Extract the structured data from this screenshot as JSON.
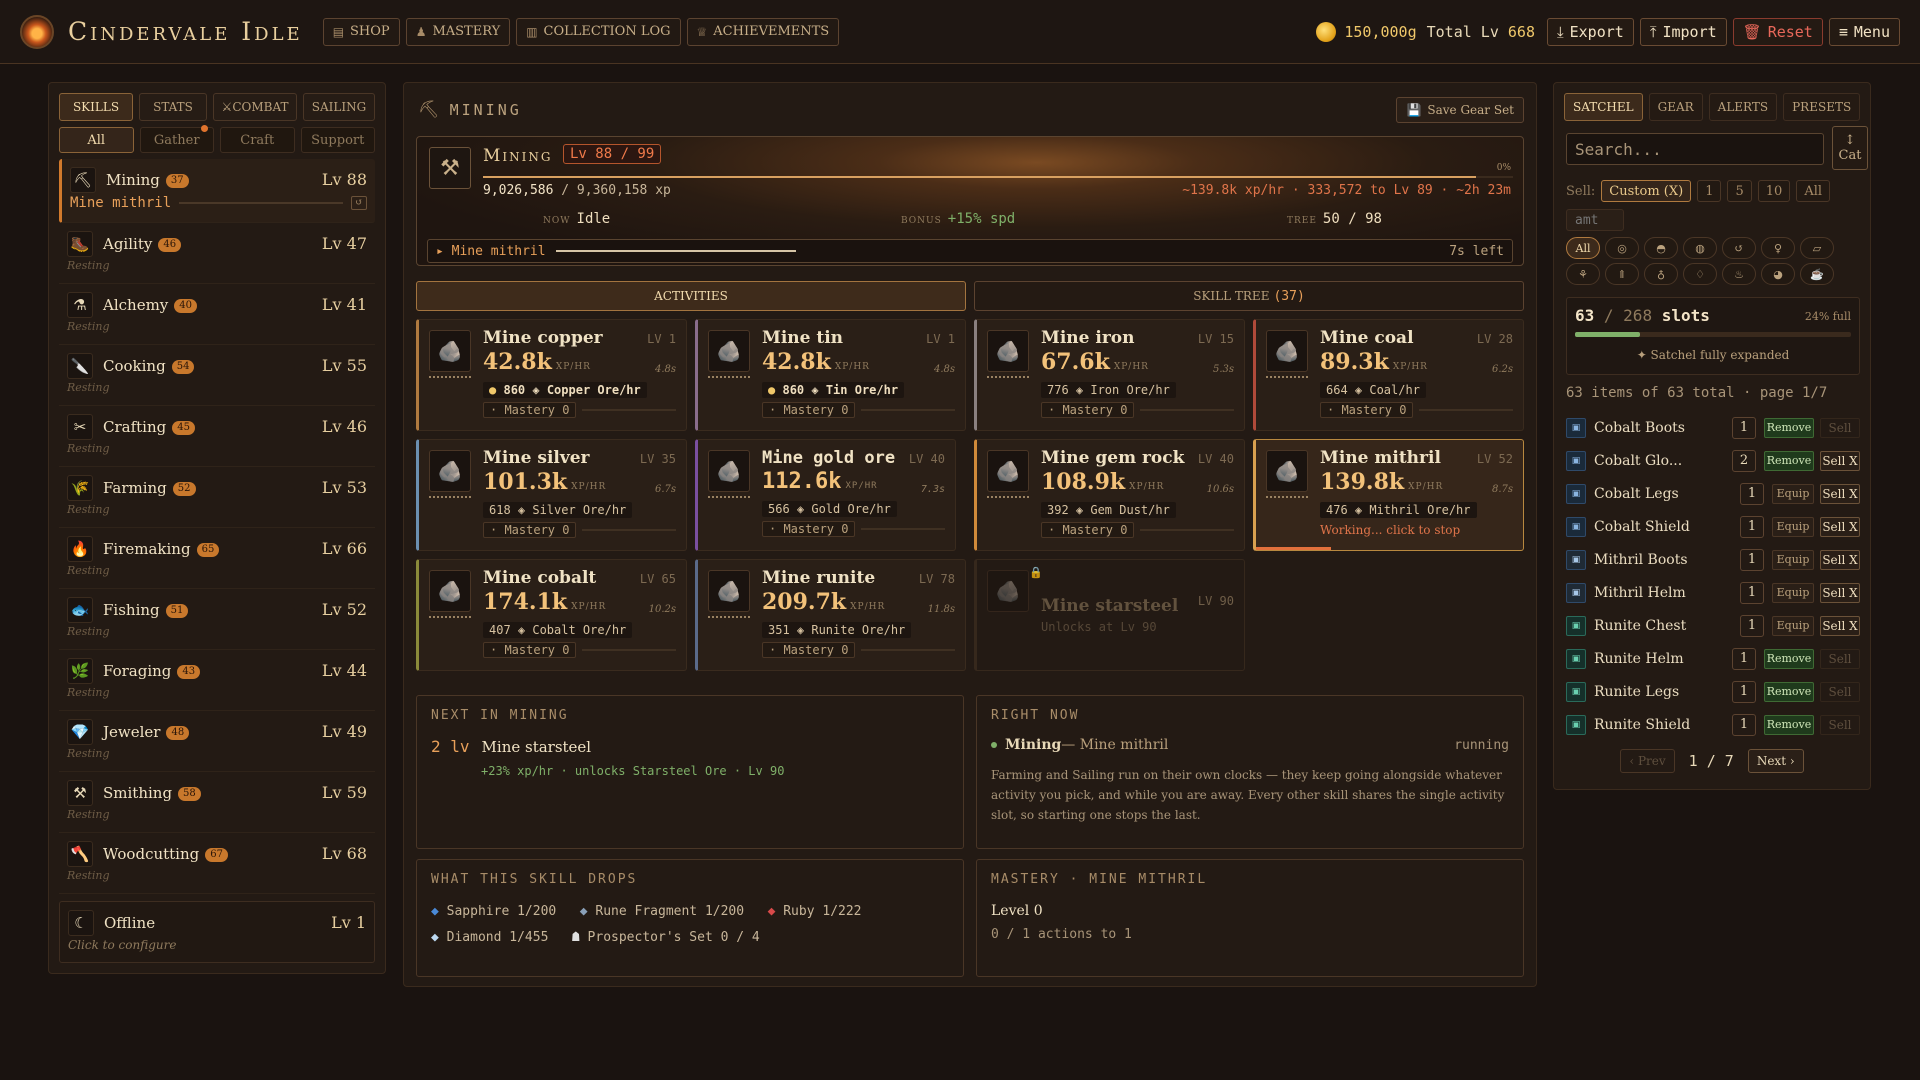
{
  "app": {
    "title": "Cindervale Idle"
  },
  "nav": {
    "shop": "SHOP",
    "mastery": "MASTERY",
    "collection": "COLLECTION LOG",
    "achievements": "ACHIEVEMENTS"
  },
  "header": {
    "gold": "150,000g",
    "total_label": "Total Lv",
    "total_value": "668",
    "export": "Export",
    "import": "Import",
    "reset": "Reset",
    "menu": "Menu"
  },
  "left": {
    "tabs": [
      "SKILLS",
      "STATS",
      "COMBAT",
      "SAILING"
    ],
    "subtabs": [
      "All",
      "Gather",
      "Craft",
      "Support"
    ],
    "active_skill": {
      "name": "Mining",
      "badge": "37",
      "level": "Lv 88",
      "activity": "Mine mithril"
    },
    "skills": [
      {
        "name": "Agility",
        "badge": "46",
        "level": "Lv 47",
        "state": "Resting",
        "icon": "🥾"
      },
      {
        "name": "Alchemy",
        "badge": "40",
        "level": "Lv 41",
        "state": "Resting",
        "icon": "⚗"
      },
      {
        "name": "Cooking",
        "badge": "54",
        "level": "Lv 55",
        "state": "Resting",
        "icon": "🔪"
      },
      {
        "name": "Crafting",
        "badge": "45",
        "level": "Lv 46",
        "state": "Resting",
        "icon": "✂"
      },
      {
        "name": "Farming",
        "badge": "52",
        "level": "Lv 53",
        "state": "Resting",
        "icon": "🌾"
      },
      {
        "name": "Firemaking",
        "badge": "65",
        "level": "Lv 66",
        "state": "Resting",
        "icon": "🔥"
      },
      {
        "name": "Fishing",
        "badge": "51",
        "level": "Lv 52",
        "state": "Resting",
        "icon": "🐟"
      },
      {
        "name": "Foraging",
        "badge": "43",
        "level": "Lv 44",
        "state": "Resting",
        "icon": "🌿"
      },
      {
        "name": "Jeweler",
        "badge": "48",
        "level": "Lv 49",
        "state": "Resting",
        "icon": "💎"
      },
      {
        "name": "Smithing",
        "badge": "58",
        "level": "Lv 59",
        "state": "Resting",
        "icon": "⚒"
      },
      {
        "name": "Woodcutting",
        "badge": "67",
        "level": "Lv 68",
        "state": "Resting",
        "icon": "🪓"
      }
    ],
    "offline": {
      "name": "Offline",
      "level": "Lv 1",
      "hint": "Click to configure"
    }
  },
  "main": {
    "title": "MINING",
    "save_gear": "Save Gear Set",
    "hero": {
      "name": "Mining",
      "level": "Lv 88 / 99",
      "xp_current": "9,026,586",
      "xp_total": "/ 9,360,158 xp",
      "xp_fraction": 0.964,
      "pct": "0%",
      "rate": "~139.8k xp/hr · 333,572 to Lv 89 · ~2h 23m",
      "now_label": "Now",
      "now_value": "Idle",
      "bonus_label": "Bonus",
      "bonus_value": "+15% spd",
      "tree_label": "Tree",
      "tree_value": "50 / 98",
      "current": "▸ Mine mithril",
      "time_left": "7s left"
    },
    "seg": {
      "activities": "ACTIVITIES",
      "skilltree": "SKILL TREE",
      "skilltree_count": "(37)"
    },
    "xphr": "XP/HR",
    "cards": [
      {
        "name": "Mine copper",
        "lv": "LV 1",
        "xp": "42.8k",
        "time": "4.8s",
        "drop": "860 ◈ Copper Ore/hr",
        "coin": true,
        "mastery": "· Mastery 0",
        "cls": "",
        "icon": "🪨"
      },
      {
        "name": "Mine tin",
        "lv": "LV 1",
        "xp": "42.8k",
        "time": "4.8s",
        "drop": "860 ◈ Tin Ore/hr",
        "coin": true,
        "mastery": "· Mastery 0",
        "cls": "tin",
        "icon": "🪨"
      },
      {
        "name": "Mine iron",
        "lv": "LV 15",
        "xp": "67.6k",
        "time": "5.3s",
        "drop": "776 ◈ Iron Ore/hr",
        "coin": false,
        "mastery": "· Mastery 0",
        "cls": "iron",
        "icon": "🪨"
      },
      {
        "name": "Mine coal",
        "lv": "LV 28",
        "xp": "89.3k",
        "time": "6.2s",
        "drop": "664 ◈ Coal/hr",
        "coin": false,
        "mastery": "· Mastery 0",
        "cls": "coal",
        "icon": "🪨"
      },
      {
        "name": "Mine silver",
        "lv": "LV 35",
        "xp": "101.3k",
        "time": "6.7s",
        "drop": "618 ◈ Silver Ore/hr",
        "coin": false,
        "mastery": "· Mastery 0",
        "cls": "silver",
        "icon": "🪨"
      },
      {
        "name": "Mine gold ore",
        "lv": "LV 40",
        "xp": "112.6k",
        "time": "7.3s",
        "drop": "566 ◈ Gold Ore/hr",
        "coin": false,
        "mastery": "· Mastery 0",
        "cls": "gold",
        "icon": "🪨"
      },
      {
        "name": "Mine gem rock",
        "lv": "LV 40",
        "xp": "108.9k",
        "time": "10.6s",
        "drop": "392 ◈ Gem Dust/hr",
        "coin": false,
        "mastery": "· Mastery 0",
        "cls": "gem",
        "icon": "🪨"
      },
      {
        "name": "Mine mithril",
        "lv": "LV 52",
        "xp": "139.8k",
        "time": "8.7s",
        "drop": "476 ◈ Mithril Ore/hr",
        "coin": false,
        "mastery": "",
        "working": "Working... click to stop",
        "cls": "mith",
        "icon": "🪨"
      },
      {
        "name": "Mine cobalt",
        "lv": "LV 65",
        "xp": "174.1k",
        "time": "10.2s",
        "drop": "407 ◈ Cobalt Ore/hr",
        "coin": false,
        "mastery": "· Mastery 0",
        "cls": "cob",
        "icon": "🪨"
      },
      {
        "name": "Mine runite",
        "lv": "LV 78",
        "xp": "209.7k",
        "time": "11.8s",
        "drop": "351 ◈ Runite Ore/hr",
        "coin": false,
        "mastery": "· Mastery 0",
        "cls": "run",
        "icon": "🪨"
      }
    ],
    "locked": {
      "name": "Mine starsteel",
      "lv": "LV 90",
      "sub": "Unlocks at Lv 90"
    },
    "next": {
      "title": "NEXT IN MINING",
      "lv": "2 lv",
      "name": "Mine starsteel",
      "detail": "+23% xp/hr · unlocks Starsteel Ore · Lv 90"
    },
    "right_now": {
      "title": "RIGHT NOW",
      "skill": "Mining",
      "activity": " — Mine mithril",
      "state": "running",
      "note": "Farming and Sailing run on their own clocks — they keep going alongside whatever activity you pick, and while you are away. Every other skill shares the single activity slot, so starting one stops the last."
    },
    "drops": {
      "title": "WHAT THIS SKILL DROPS",
      "items": [
        "Sapphire 1/200",
        "Rune Fragment 1/200",
        "Ruby 1/222",
        "Diamond 1/455",
        "Prospector's Set 0 / 4"
      ]
    },
    "mastery": {
      "title": "MASTERY · MINE MITHRIL",
      "level": "Level 0",
      "actions": "0 / 1 actions to 1"
    }
  },
  "right": {
    "tabs": [
      "SATCHEL",
      "GEAR",
      "ALERTS",
      "PRESETS"
    ],
    "search_placeholder": "Search...",
    "cat": "Cat",
    "sell_label": "Sell:",
    "sell_opts": [
      "Custom (X)",
      "1",
      "5",
      "10",
      "All"
    ],
    "amt": "amt",
    "filter_all": "All",
    "slots": {
      "used": "63",
      "total": "/ 268",
      "unit": "slots",
      "pct": "24% full",
      "fraction": 0.235,
      "expanded": "✦ Satchel fully expanded"
    },
    "count": "63 items of 63 total · page 1/7",
    "items": [
      {
        "name": "Cobalt Boots",
        "qty": "1",
        "act": "Remove",
        "sell": "Sell",
        "sell_on": false,
        "ic": ""
      },
      {
        "name": "Cobalt Glo...",
        "qty": "2",
        "act": "Remove",
        "sell": "Sell X",
        "sell_on": true,
        "ic": ""
      },
      {
        "name": "Cobalt Legs",
        "qty": "1",
        "act": "Equip",
        "sell": "Sell X",
        "sell_on": true,
        "ic": ""
      },
      {
        "name": "Cobalt Shield",
        "qty": "1",
        "act": "Equip",
        "sell": "Sell X",
        "sell_on": true,
        "ic": ""
      },
      {
        "name": "Mithril Boots",
        "qty": "1",
        "act": "Equip",
        "sell": "Sell X",
        "sell_on": true,
        "ic": "mith"
      },
      {
        "name": "Mithril Helm",
        "qty": "1",
        "act": "Equip",
        "sell": "Sell X",
        "sell_on": true,
        "ic": "mith"
      },
      {
        "name": "Runite Chest",
        "qty": "1",
        "act": "Equip",
        "sell": "Sell X",
        "sell_on": true,
        "ic": "run"
      },
      {
        "name": "Runite Helm",
        "qty": "1",
        "act": "Remove",
        "sell": "Sell",
        "sell_on": false,
        "ic": "run"
      },
      {
        "name": "Runite Legs",
        "qty": "1",
        "act": "Remove",
        "sell": "Sell",
        "sell_on": false,
        "ic": "run"
      },
      {
        "name": "Runite Shield",
        "qty": "1",
        "act": "Remove",
        "sell": "Sell",
        "sell_on": false,
        "ic": "run"
      }
    ],
    "pager": {
      "prev": "‹ Prev",
      "page": "1 / 7",
      "next": "Next ›"
    }
  },
  "colors": {
    "accent": "#d27a2c",
    "bg": "#1a1310",
    "good": "#7fb069",
    "warn": "#e0744a"
  }
}
